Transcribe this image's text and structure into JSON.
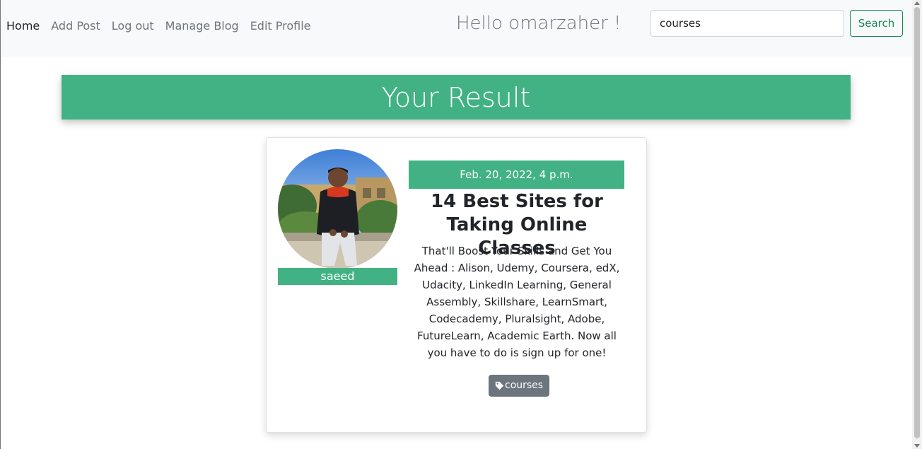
{
  "nav": {
    "items": [
      {
        "label": "Home",
        "active": true
      },
      {
        "label": "Add Post",
        "active": false
      },
      {
        "label": "Log out",
        "active": false
      },
      {
        "label": "Manage Blog",
        "active": false
      },
      {
        "label": "Edit Profile",
        "active": false
      }
    ],
    "greeting": "Hello omarzaher !",
    "search": {
      "value": "courses",
      "button_label": "Search"
    }
  },
  "banner": {
    "title": "Your Result"
  },
  "post": {
    "author": "saeed",
    "date": "Feb. 20, 2022, 4 p.m.",
    "title": "14 Best Sites for Taking Online Classes",
    "body": "That'll Boost Your Skills and Get You Ahead : Alison, Udemy, Coursera, edX, Udacity, LinkedIn Learning, General Assembly, Skillshare, LearnSmart, Codecademy, Pluralsight, Adobe, FutureLearn, Academic Earth. Now all you have to do is sign up for one!",
    "tag": "courses"
  },
  "colors": {
    "accent": "#42b284",
    "search_outline": "#198754",
    "tag_bg": "#6c757d",
    "navbar_bg": "#f8f9fa"
  },
  "icons": {
    "tag": "tag-icon"
  }
}
